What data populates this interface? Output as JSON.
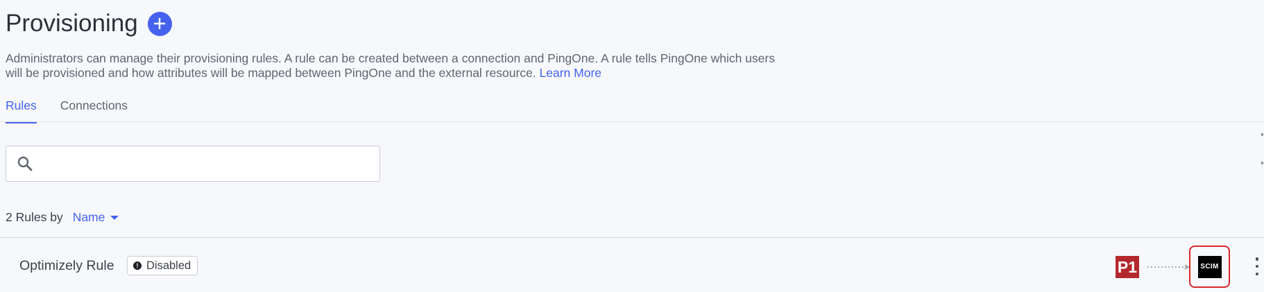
{
  "header": {
    "title": "Provisioning",
    "add_icon": "plus-icon"
  },
  "description": {
    "text": "Administrators can manage their provisioning rules. A rule can be created between a connection and PingOne. A rule tells PingOne which users will be provisioned and how attributes will be mapped between PingOne and the external resource.",
    "link_label": "Learn More"
  },
  "tabs": [
    {
      "label": "Rules",
      "active": true
    },
    {
      "label": "Connections",
      "active": false
    }
  ],
  "search": {
    "icon": "search-icon",
    "value": "",
    "placeholder": ""
  },
  "sort": {
    "count_label": "2 Rules by",
    "field_label": "Name"
  },
  "rules": [
    {
      "name": "Optimizely Rule",
      "status": "Disabled",
      "source_logo": "P1",
      "target_logo": "SCIM"
    }
  ],
  "colors": {
    "accent": "#4462ed",
    "pingone_red": "#b3282d",
    "highlight_red": "#d9262c"
  }
}
